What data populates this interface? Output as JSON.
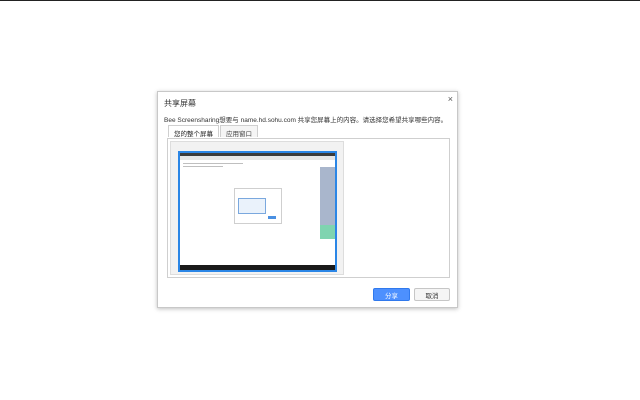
{
  "dialog": {
    "title": "共享屏幕",
    "description": "Bee Screensharing想要与 name.hd.sohu.com 共享您屏幕上的内容。请选择您希望共享哪些内容。",
    "tabs": [
      {
        "label": "您的整个屏幕",
        "selected": true
      },
      {
        "label": "应用窗口",
        "selected": false
      }
    ],
    "share_label": "分享",
    "cancel_label": "取消",
    "close_glyph": "×"
  },
  "colors": {
    "accent": "#2b86e6",
    "share_button": "#4d90fe"
  }
}
